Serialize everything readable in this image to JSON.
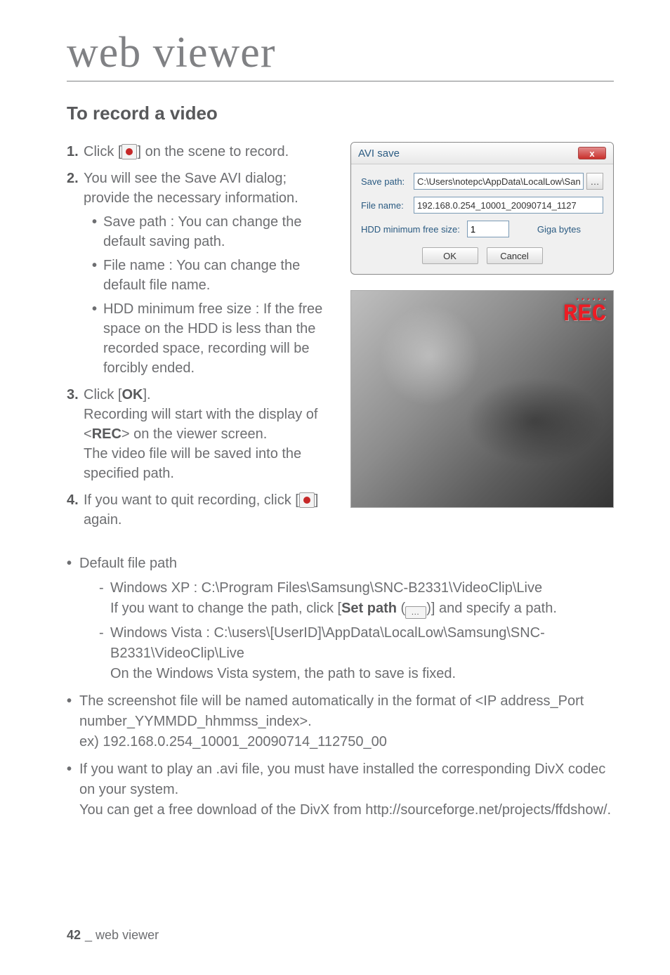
{
  "page_title": "web viewer",
  "section_title": "To record a video",
  "steps": {
    "s1": {
      "num": "1.",
      "pre": "Click [",
      "post": "] on the scene to record."
    },
    "s2": {
      "num": "2.",
      "text": "You will see the Save AVI dialog; provide the necessary information."
    },
    "s2_subs": [
      "Save path : You can change the default saving path.",
      "File name : You can change the default file name.",
      "HDD minimum free size : If the free space on the HDD is less than the recorded space, recording will be forcibly ended."
    ],
    "s3": {
      "num": "3.",
      "pre": "Click [",
      "ok": "OK",
      "post": "].",
      "line2a": "Recording will start with the display of <",
      "rec": "REC",
      "line2b": "> on the viewer screen.",
      "line3": "The video file will be saved into the specified path."
    },
    "s4": {
      "num": "4.",
      "pre": "If you want to quit recording, click [",
      "post": "] again."
    }
  },
  "dialog": {
    "title": "AVI save",
    "close_glyph": "x",
    "save_path_label": "Save path:",
    "save_path_value": "C:\\Users\\notepc\\AppData\\LocalLow\\San",
    "browse_glyph": "…",
    "file_name_label": "File name:",
    "file_name_value": "192.168.0.254_10001_20090714_1127",
    "hdd_label": "HDD minimum free size:",
    "hdd_value": "1",
    "hdd_unit": "Giga bytes",
    "ok": "OK",
    "cancel": "Cancel"
  },
  "preview": {
    "rec": "REC",
    "dots_top": "• • • • • •",
    "dots_side": "•\n•\n•"
  },
  "notes": {
    "default_file_path": "Default file path",
    "xp_a": "Windows XP : C:\\Program Files\\Samsung\\SNC-B2331\\VideoClip\\Live",
    "xp_b_pre": "If you want to change the path, click [",
    "xp_b_bold": "Set path",
    "xp_b_mid": " (",
    "xp_b_icon": "…",
    "xp_b_post": ")] and specify a path.",
    "vista_a": "Windows Vista : C:\\users\\[UserID]\\AppData\\LocalLow\\Samsung\\SNC-B2331\\VideoClip\\Live",
    "vista_b": "On the Windows Vista system, the path to save is fixed.",
    "naming_a": "The screenshot file will be named automatically in the format of <IP address_Port number_YYMMDD_hhmmss_index>.",
    "naming_b": "ex) 192.168.0.254_10001_20090714_112750_00",
    "divx_a": "If you want to play an .avi file, you must have installed the corresponding DivX codec on your system.",
    "divx_b": "You can get a free download of the DivX from http://sourceforge.net/projects/ffdshow/."
  },
  "footer": {
    "page": "42",
    "label": "web viewer"
  }
}
